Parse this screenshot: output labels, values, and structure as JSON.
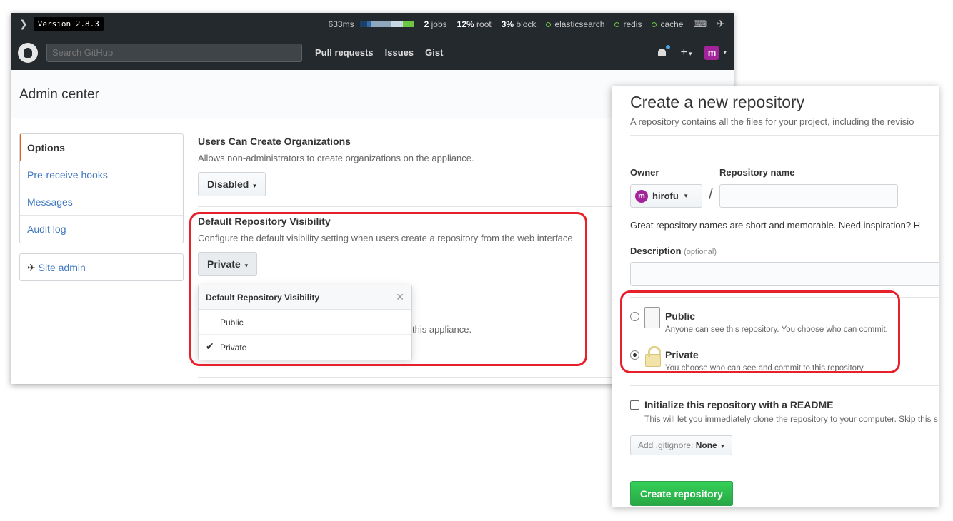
{
  "stafftools": {
    "version": "Version 2.8.3",
    "timing": "633ms",
    "jobs_count": "2",
    "jobs_label": "jobs",
    "root_pct": "12%",
    "root_label": "root",
    "block_pct": "3%",
    "block_label": "block",
    "services": [
      "elasticsearch",
      "redis",
      "cache"
    ]
  },
  "header": {
    "search_placeholder": "Search GitHub",
    "nav": [
      "Pull requests",
      "Issues",
      "Gist"
    ],
    "plus": "+",
    "avatar_letter": "m"
  },
  "admin": {
    "title": "Admin center",
    "sidebar": [
      {
        "label": "Options",
        "selected": true
      },
      {
        "label": "Pre-receive hooks",
        "selected": false
      },
      {
        "label": "Messages",
        "selected": false
      },
      {
        "label": "Audit log",
        "selected": false
      }
    ],
    "site_admin": "Site admin",
    "settings": {
      "orgs_title": "Users Can Create Organizations",
      "orgs_desc": "Allows non-administrators to create organizations on the appliance.",
      "orgs_value": "Disabled",
      "vis_title": "Default Repository Visibility",
      "vis_desc": "Configure the default visibility setting when users create a repository from the web interface.",
      "vis_value": "Private"
    },
    "dropdown": {
      "title": "Default Repository Visibility",
      "options": [
        "Public",
        "Private"
      ],
      "selected": "Private"
    },
    "obscured_text": "this appliance."
  },
  "new_repo": {
    "title": "Create a new repository",
    "subtitle": "A repository contains all the files for your project, including the revisio",
    "owner_label": "Owner",
    "owner_value": "hirofu",
    "owner_avatar": "m",
    "name_label": "Repository name",
    "slash": "/",
    "hint": "Great repository names are short and memorable. Need inspiration? H",
    "description_label": "Description",
    "description_optional": "(optional)",
    "visibility": {
      "public_title": "Public",
      "public_desc": "Anyone can see this repository. You choose who can commit.",
      "private_title": "Private",
      "private_desc": "You choose who can see and commit to this repository.",
      "selected": "Private"
    },
    "readme_label": "Initialize this repository with a README",
    "readme_desc": "This will let you immediately clone the repository to your computer. Skip this s",
    "gitignore_label": "Add .gitignore:",
    "gitignore_value": "None",
    "create_button": "Create repository"
  },
  "colors": {
    "highlight": "#e8202a",
    "header_bg": "#24292e",
    "link": "#4078c0",
    "create_green": "#28a745",
    "avatar": "#a3249a"
  }
}
